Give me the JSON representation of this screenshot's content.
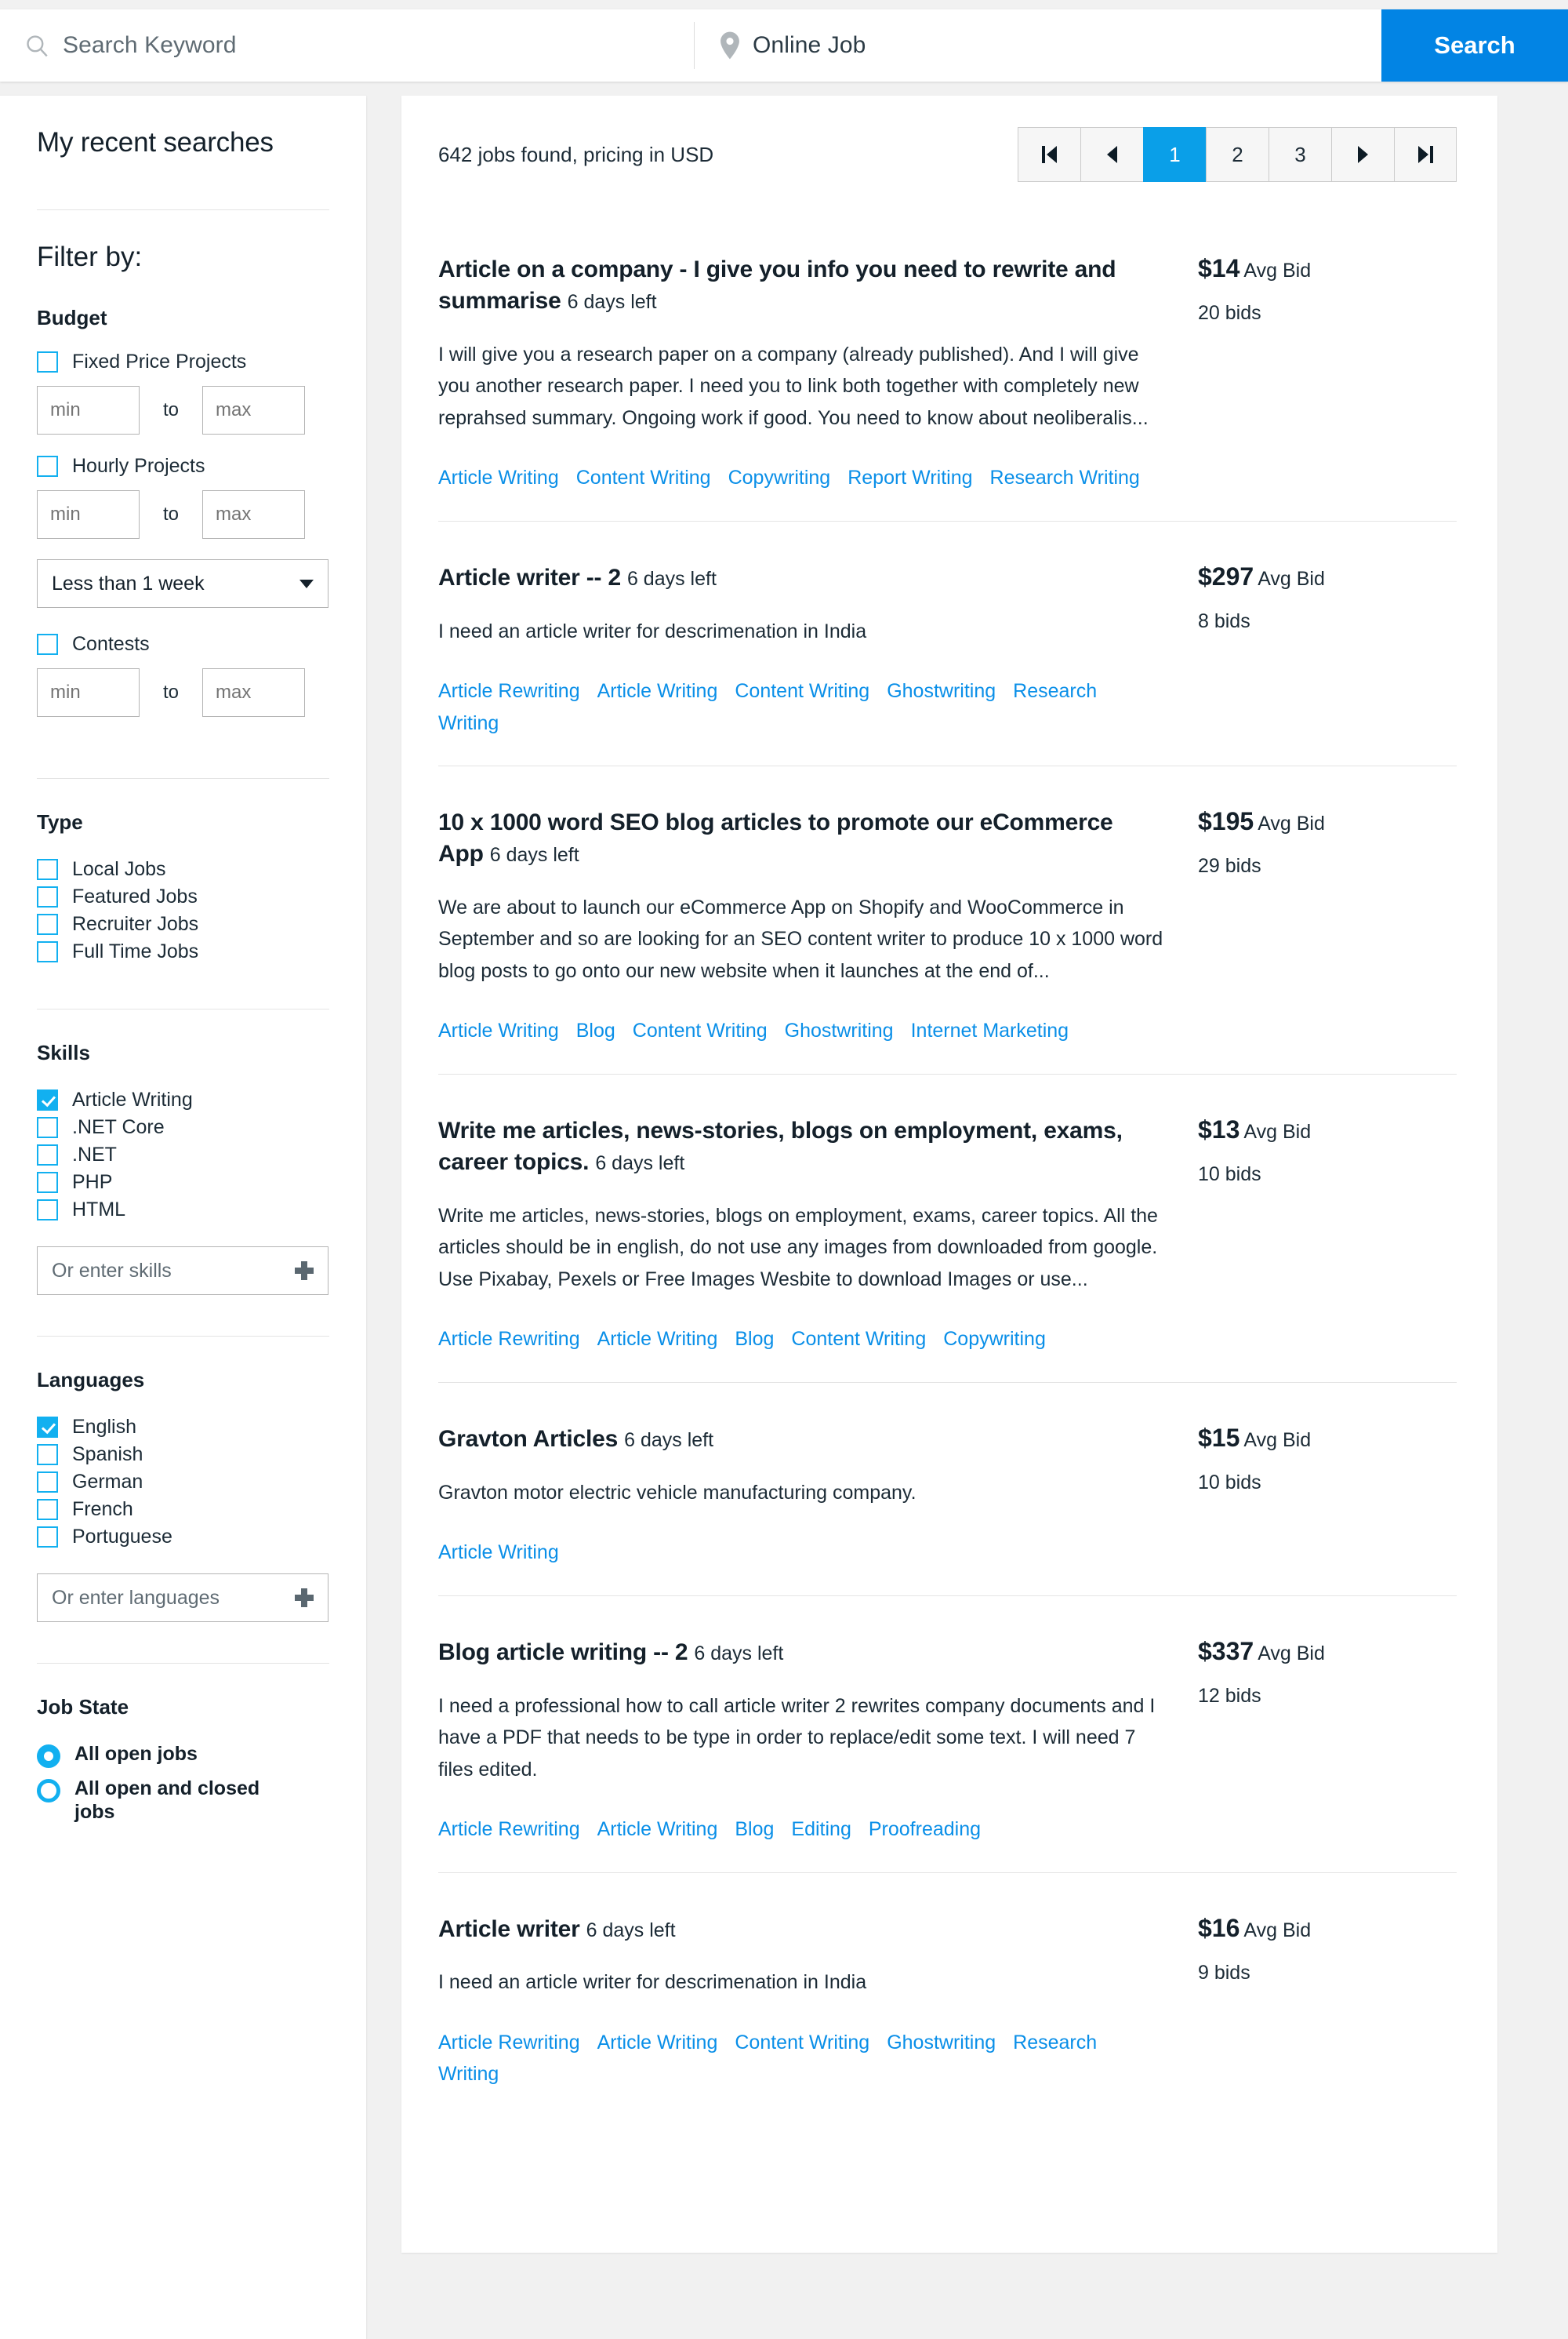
{
  "search": {
    "keyword_placeholder": "Search Keyword",
    "keyword_value": "",
    "location_value": "Online Job",
    "location_placeholder": "Online Job",
    "search_button": "Search",
    "keyword_icon": "search-icon",
    "location_icon": "map-pin-icon",
    "button_color": "#0284e4"
  },
  "sidebar": {
    "recent_searches_title": "My recent searches",
    "filter_title": "Filter by:",
    "accent_color": "#12b0f0",
    "budget": {
      "title": "Budget",
      "fixed_price_label": "Fixed Price Projects",
      "fixed_price_checked": false,
      "hourly_label": "Hourly Projects",
      "hourly_checked": false,
      "contests_label": "Contests",
      "contests_checked": false,
      "min_placeholder": "min",
      "max_placeholder": "max",
      "to_label": "to",
      "duration_selected": "Less than 1 week"
    },
    "type": {
      "title": "Type",
      "items": [
        {
          "label": "Local Jobs",
          "checked": false
        },
        {
          "label": "Featured Jobs",
          "checked": false
        },
        {
          "label": "Recruiter Jobs",
          "checked": false
        },
        {
          "label": "Full Time Jobs",
          "checked": false
        }
      ]
    },
    "skills": {
      "title": "Skills",
      "items": [
        {
          "label": "Article Writing",
          "checked": true
        },
        {
          "label": ".NET Core",
          "checked": false
        },
        {
          "label": ".NET",
          "checked": false
        },
        {
          "label": "PHP",
          "checked": false
        },
        {
          "label": "HTML",
          "checked": false
        }
      ],
      "input_placeholder": "Or enter skills"
    },
    "languages": {
      "title": "Languages",
      "items": [
        {
          "label": "English",
          "checked": true
        },
        {
          "label": "Spanish",
          "checked": false
        },
        {
          "label": "German",
          "checked": false
        },
        {
          "label": "French",
          "checked": false
        },
        {
          "label": "Portuguese",
          "checked": false
        }
      ],
      "input_placeholder": "Or enter languages"
    },
    "job_state": {
      "title": "Job State",
      "options": [
        {
          "label": "All open jobs",
          "selected": true
        },
        {
          "label": "All open and closed jobs",
          "selected": false
        }
      ]
    }
  },
  "results": {
    "count_text": "642 jobs found, pricing in USD",
    "pagination": {
      "first_icon": "first-page-icon",
      "prev_icon": "previous-page-icon",
      "pages": [
        "1",
        "2",
        "3"
      ],
      "active_page": "1",
      "next_icon": "next-page-icon",
      "last_icon": "last-page-icon",
      "active_color": "#0a9fe8"
    },
    "jobs": [
      {
        "title": "Article on a company - I give you info you need to rewrite and summarise",
        "days_left": "6 days left",
        "description": "I will give you a research paper on a company (already published). And I will give you another research paper. I need you to link both together with completely new reprahsed summary. Ongoing work if good. You need to know about neoliberalis...",
        "tags": [
          "Article Writing",
          "Content Writing",
          "Copywriting",
          "Report Writing",
          "Research Writing"
        ],
        "price": "$14",
        "price_label": "Avg Bid",
        "bids": "20 bids"
      },
      {
        "title": "Article writer -- 2",
        "days_left": "6 days left",
        "description": "I need an article writer for descrimenation in India",
        "tags": [
          "Article Rewriting",
          "Article Writing",
          "Content Writing",
          "Ghostwriting",
          "Research Writing"
        ],
        "price": "$297",
        "price_label": "Avg Bid",
        "bids": "8 bids"
      },
      {
        "title": "10 x 1000 word SEO blog articles to promote our eCommerce App",
        "days_left": "6 days left",
        "description": "We are about to launch our eCommerce App on Shopify and WooCommerce in September and so are looking for an SEO content writer to produce 10 x 1000 word blog posts to go onto our new website when it launches at the end of...",
        "tags": [
          "Article Writing",
          "Blog",
          "Content Writing",
          "Ghostwriting",
          "Internet Marketing"
        ],
        "price": "$195",
        "price_label": "Avg Bid",
        "bids": "29 bids"
      },
      {
        "title": "Write me articles, news-stories, blogs on employment, exams, career topics.",
        "days_left": "6 days left",
        "description": "Write me articles, news-stories, blogs on employment, exams, career topics. All the articles should be in english, do not use any images from downloaded from google. Use Pixabay, Pexels or Free Images Wesbite to download Images or use...",
        "tags": [
          "Article Rewriting",
          "Article Writing",
          "Blog",
          "Content Writing",
          "Copywriting"
        ],
        "price": "$13",
        "price_label": "Avg Bid",
        "bids": "10 bids"
      },
      {
        "title": "Gravton Articles",
        "days_left": "6 days left",
        "description": "Gravton motor electric vehicle manufacturing company.",
        "tags": [
          "Article Writing"
        ],
        "price": "$15",
        "price_label": "Avg Bid",
        "bids": "10 bids"
      },
      {
        "title": "Blog article writing -- 2",
        "days_left": "6 days left",
        "description": "I need a professional how to call article writer 2 rewrites company documents and I have a PDF that needs to be type in order to replace/edit some text. I will need 7 files edited.",
        "tags": [
          "Article Rewriting",
          "Article Writing",
          "Blog",
          "Editing",
          "Proofreading"
        ],
        "price": "$337",
        "price_label": "Avg Bid",
        "bids": "12 bids"
      },
      {
        "title": "Article writer",
        "days_left": "6 days left",
        "description": "I need an article writer for descrimenation in India",
        "tags": [
          "Article Rewriting",
          "Article Writing",
          "Content Writing",
          "Ghostwriting",
          "Research Writing"
        ],
        "price": "$16",
        "price_label": "Avg Bid",
        "bids": "9 bids"
      }
    ]
  }
}
